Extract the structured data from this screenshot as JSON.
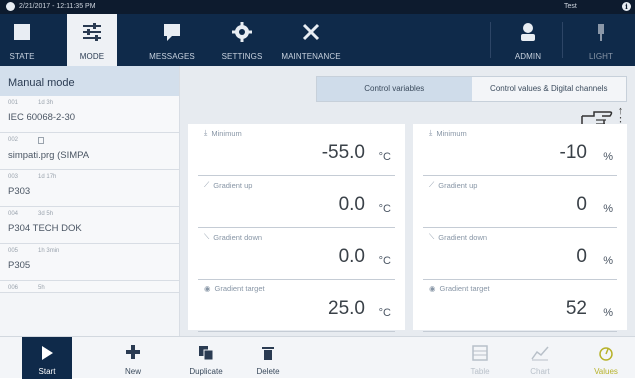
{
  "status_bar": {
    "datetime": "2/21/2017 - 12:11:35 PM",
    "user": "Test"
  },
  "top_nav": {
    "items": [
      {
        "label": "STATE",
        "icon": "state-square-icon",
        "active": false
      },
      {
        "label": "MODE",
        "icon": "sliders-icon",
        "active": true
      },
      {
        "label": "MESSAGES",
        "icon": "message-icon",
        "active": false
      },
      {
        "label": "SETTINGS",
        "icon": "gear-icon",
        "active": false
      },
      {
        "label": "MAINTENANCE",
        "icon": "wrench-icon",
        "active": false
      },
      {
        "label": "ADMIN",
        "icon": "admin-user-icon",
        "active": false
      },
      {
        "label": "LIGHT",
        "icon": "light-icon",
        "active": false
      }
    ]
  },
  "left_panel": {
    "header": "Manual mode",
    "programs": [
      {
        "number": "001",
        "time": "1d 3h",
        "name": "IEC 60068-2-30"
      },
      {
        "number": "002",
        "time": "",
        "name": "simpati.prg (SIMPA"
      },
      {
        "number": "003",
        "time": "1d 17h",
        "name": "P303"
      },
      {
        "number": "004",
        "time": "3d 5h",
        "name": "P304 TECH DOK"
      },
      {
        "number": "005",
        "time": "1h 3min",
        "name": "P305"
      },
      {
        "number": "006",
        "time": "5h",
        "name": ""
      }
    ]
  },
  "tabs": [
    {
      "label": "Control variables",
      "active": true
    },
    {
      "label": "Control values & Digital channels",
      "active": false
    }
  ],
  "temperature": {
    "minimum_label": "Minimum",
    "minimum_value": "-55.0",
    "unit": "°C",
    "gradient_up_label": "Gradient up",
    "gradient_up_value": "0.0",
    "gradient_down_label": "Gradient down",
    "gradient_down_value": "0.0",
    "gradient_target_label": "Gradient target",
    "gradient_target_value": "25.0"
  },
  "humidity": {
    "minimum_label": "Minimum",
    "minimum_value": "-10",
    "unit": "%",
    "gradient_up_label": "Gradient up",
    "gradient_up_value": "0",
    "gradient_down_label": "Gradient down",
    "gradient_down_value": "0",
    "gradient_target_label": "Gradient target",
    "gradient_target_value": "52"
  },
  "bottom_bar": {
    "start": "Start",
    "new": "New",
    "duplicate": "Duplicate",
    "delete": "Delete",
    "table": "Table",
    "chart": "Chart",
    "values": "Values"
  },
  "colors": {
    "nav_bg": "#0f2a4a",
    "active_tab": "#cfdcea",
    "values_accent": "#b7b22a"
  }
}
